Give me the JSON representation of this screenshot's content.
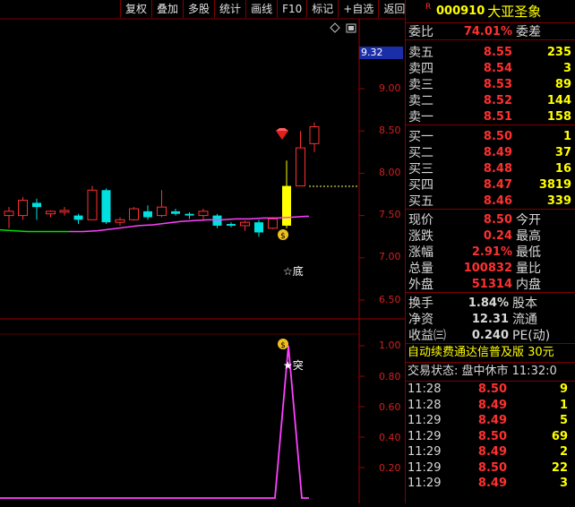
{
  "toolbar": [
    "复权",
    "叠加",
    "多股",
    "统计",
    "画线",
    "F10",
    "标记",
    "+自选",
    "返回"
  ],
  "chart": {
    "last_price_flag": "9.32",
    "price_axis": [
      "9.00",
      "8.50",
      "8.00",
      "7.50",
      "7.00",
      "6.50"
    ],
    "indicator_axis": [
      "1.00",
      "0.80",
      "0.60",
      "0.40",
      "0.20"
    ],
    "annotation_bottom": "☆底",
    "annotation_signal": "★突"
  },
  "chart_data": {
    "type": "candlestick",
    "price_ylim": [
      6.3,
      9.6
    ],
    "candles": [
      {
        "o": 7.5,
        "h": 7.6,
        "l": 7.35,
        "c": 7.55
      },
      {
        "o": 7.5,
        "h": 7.72,
        "l": 7.45,
        "c": 7.68
      },
      {
        "o": 7.65,
        "h": 7.7,
        "l": 7.45,
        "c": 7.6
      },
      {
        "o": 7.52,
        "h": 7.56,
        "l": 7.48,
        "c": 7.55
      },
      {
        "o": 7.54,
        "h": 7.6,
        "l": 7.5,
        "c": 7.56
      },
      {
        "o": 7.5,
        "h": 7.52,
        "l": 7.4,
        "c": 7.45
      },
      {
        "o": 7.45,
        "h": 7.85,
        "l": 7.45,
        "c": 7.8
      },
      {
        "o": 7.8,
        "h": 7.82,
        "l": 7.4,
        "c": 7.42
      },
      {
        "o": 7.42,
        "h": 7.48,
        "l": 7.38,
        "c": 7.45
      },
      {
        "o": 7.45,
        "h": 7.6,
        "l": 7.44,
        "c": 7.58
      },
      {
        "o": 7.55,
        "h": 7.62,
        "l": 7.45,
        "c": 7.48
      },
      {
        "o": 7.5,
        "h": 7.8,
        "l": 7.48,
        "c": 7.6
      },
      {
        "o": 7.55,
        "h": 7.58,
        "l": 7.5,
        "c": 7.52
      },
      {
        "o": 7.52,
        "h": 7.54,
        "l": 7.46,
        "c": 7.5
      },
      {
        "o": 7.5,
        "h": 7.58,
        "l": 7.45,
        "c": 7.55
      },
      {
        "o": 7.5,
        "h": 7.52,
        "l": 7.35,
        "c": 7.38
      },
      {
        "o": 7.4,
        "h": 7.42,
        "l": 7.36,
        "c": 7.38
      },
      {
        "o": 7.38,
        "h": 7.44,
        "l": 7.32,
        "c": 7.42
      },
      {
        "o": 7.42,
        "h": 7.45,
        "l": 7.25,
        "c": 7.3
      },
      {
        "o": 7.35,
        "h": 7.48,
        "l": 7.34,
        "c": 7.46
      },
      {
        "o": 7.85,
        "h": 8.15,
        "l": 7.35,
        "c": 7.38
      },
      {
        "o": 7.85,
        "h": 8.5,
        "l": 7.85,
        "c": 8.3
      },
      {
        "o": 8.35,
        "h": 8.6,
        "l": 8.25,
        "c": 8.55
      }
    ],
    "ma": [
      7.33,
      7.32,
      7.31,
      7.31,
      7.31,
      7.31,
      7.31,
      7.32,
      7.34,
      7.36,
      7.38,
      7.39,
      7.41,
      7.43,
      7.44,
      7.45,
      7.45,
      7.46,
      7.46,
      7.47,
      7.47,
      7.48,
      7.49
    ],
    "indicator": [
      0,
      0,
      0,
      0,
      0,
      0,
      0,
      0,
      0,
      0,
      0,
      0,
      0,
      0,
      0,
      0,
      0,
      0,
      0,
      0,
      0,
      1.0,
      0
    ],
    "indicator_ylim": [
      0,
      1.15
    ]
  },
  "quote": {
    "r_mark": "R",
    "code": "000910",
    "name": "大亚圣象",
    "weibi_label": "委比",
    "weibi_value": "74.01%",
    "weicha_label": "委差",
    "asks": [
      {
        "label": "卖五",
        "price": "8.55",
        "vol": "235"
      },
      {
        "label": "卖四",
        "price": "8.54",
        "vol": "3"
      },
      {
        "label": "卖三",
        "price": "8.53",
        "vol": "89"
      },
      {
        "label": "卖二",
        "price": "8.52",
        "vol": "144"
      },
      {
        "label": "卖一",
        "price": "8.51",
        "vol": "158"
      }
    ],
    "bids": [
      {
        "label": "买一",
        "price": "8.50",
        "vol": "1"
      },
      {
        "label": "买二",
        "price": "8.49",
        "vol": "37"
      },
      {
        "label": "买三",
        "price": "8.48",
        "vol": "16"
      },
      {
        "label": "买四",
        "price": "8.47",
        "vol": "3819"
      },
      {
        "label": "买五",
        "price": "8.46",
        "vol": "339"
      }
    ],
    "stats": [
      {
        "l1": "现价",
        "v1": "8.50",
        "l2": "今开",
        "v2": ""
      },
      {
        "l1": "涨跌",
        "v1": "0.24",
        "l2": "最高",
        "v2": ""
      },
      {
        "l1": "涨幅",
        "v1": "2.91%",
        "l2": "最低",
        "v2": ""
      },
      {
        "l1": "总量",
        "v1": "100832",
        "l2": "量比",
        "v2": ""
      },
      {
        "l1": "外盘",
        "v1": "51314",
        "l2": "内盘",
        "v2": ""
      }
    ],
    "stats2": [
      {
        "l1": "换手",
        "v1": "1.84%",
        "l2": "股本"
      },
      {
        "l1": "净资",
        "v1": "12.31",
        "l2": "流通"
      },
      {
        "l1": "收益㈢",
        "v1": "0.240",
        "l2": "PE(动)"
      }
    ],
    "news": "自动续费通达信普及版  30元",
    "status": "交易状态: 盘中休市 11:32:0",
    "ticks": [
      {
        "t": "11:28",
        "p": "8.50",
        "v": "9"
      },
      {
        "t": "11:28",
        "p": "8.49",
        "v": "1"
      },
      {
        "t": "11:29",
        "p": "8.49",
        "v": "5"
      },
      {
        "t": "11:29",
        "p": "8.50",
        "v": "69"
      },
      {
        "t": "11:29",
        "p": "8.49",
        "v": "2"
      },
      {
        "t": "11:29",
        "p": "8.50",
        "v": "22"
      },
      {
        "t": "11:29",
        "p": "8.49",
        "v": "3"
      }
    ]
  }
}
